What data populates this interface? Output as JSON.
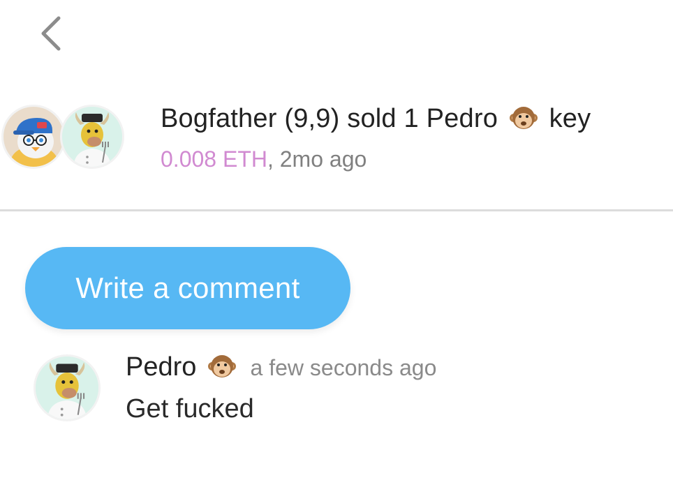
{
  "icons": {
    "back": "chevron-left-icon",
    "monkey": "see-no-evil-monkey-emoji"
  },
  "colors": {
    "price": "#d18ad1",
    "button": "#57b8f4",
    "muted_text": "#808080",
    "divider": "#dcdcdc"
  },
  "activity": {
    "seller_name": "Bogfather (9,9)",
    "action": "sold 1",
    "subject_name": "Pedro",
    "item": "key",
    "price": "0.008 ETH",
    "separator": ",",
    "time": "2mo ago"
  },
  "comment_button": {
    "label": "Write a comment"
  },
  "comment": {
    "author": "Pedro",
    "time": "a few seconds ago",
    "text": "Get fucked"
  }
}
